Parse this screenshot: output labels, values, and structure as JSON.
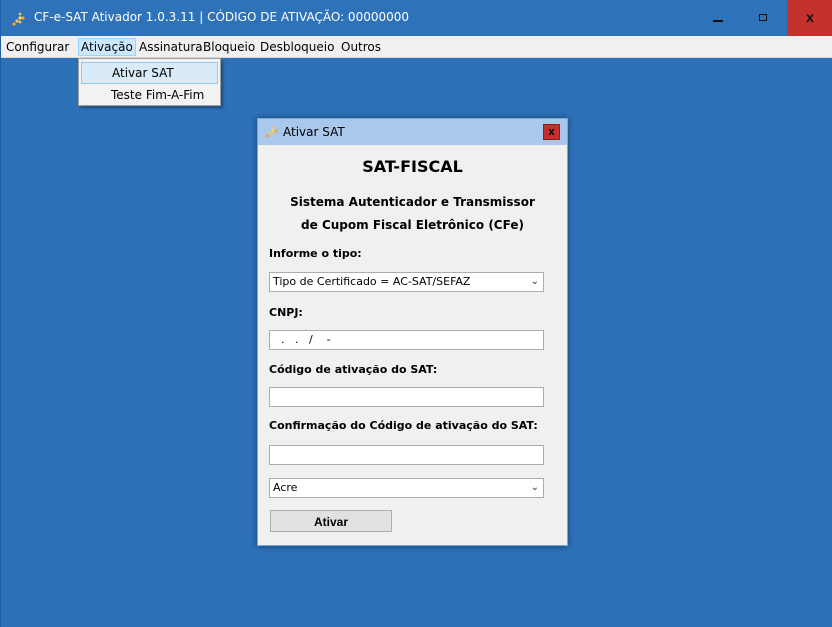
{
  "window": {
    "title": "CF-e-SAT Ativador 1.0.3.11 | CÓDIGO DE ATIVAÇÃO: 00000000",
    "icon": "app-arrow-icon",
    "buttons": {
      "minimize": "minimize-icon",
      "maximize": "maximize-icon",
      "close": "x"
    }
  },
  "menu": {
    "items": [
      "Configurar",
      "Ativação",
      "Assinatura",
      "Bloqueio",
      "Desbloqueio",
      "Outros"
    ],
    "active": "Ativação",
    "dropdown": [
      "Ativar SAT",
      "Teste Fim-A-Fim"
    ]
  },
  "dialog": {
    "title": "Ativar SAT",
    "close": "x",
    "heading": "SAT-FISCAL",
    "subtitle_line1": "Sistema Autenticador e Transmissor",
    "subtitle_line2": "de Cupom Fiscal Eletrônico (CFe)",
    "type_label": "Informe o tipo:",
    "type_value": "Tipo de Certificado = AC-SAT/SEFAZ",
    "cnpj_label": "CNPJ:",
    "cnpj_value": "  .   .   /    -",
    "code_label": "Código de ativação do SAT:",
    "code_value": "",
    "confirm_label": "Confirmação do Código de ativação do SAT:",
    "confirm_value": "",
    "state_value": "Acre",
    "activate_button": "Ativar",
    "chevron": "⌄"
  },
  "colors": {
    "desktop": "#2d71b9",
    "titlebar": "#2e72ba",
    "close_red": "#c4302b",
    "dialog_title": "#a9c8ec"
  }
}
